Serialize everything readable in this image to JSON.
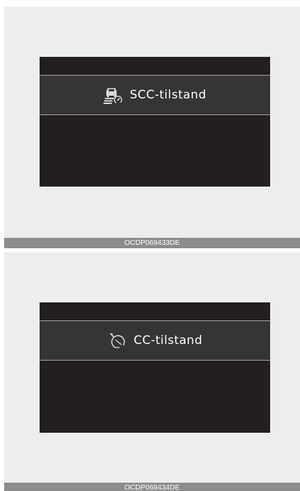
{
  "figures": [
    {
      "menu_label": "SCC-tilstand",
      "icon": "smart-cruise-control-icon",
      "caption": "OCDP069433DE"
    },
    {
      "menu_label": "CC-tilstand",
      "icon": "cruise-control-icon",
      "caption": "OCDP069434DE"
    }
  ],
  "colors": {
    "panel_background": "#ededed",
    "screen_background": "#231f20",
    "menu_row_background": "#373435",
    "divider": "#a7a7a7",
    "caption_bar": "#8b8c8d",
    "text": "#ffffff"
  }
}
